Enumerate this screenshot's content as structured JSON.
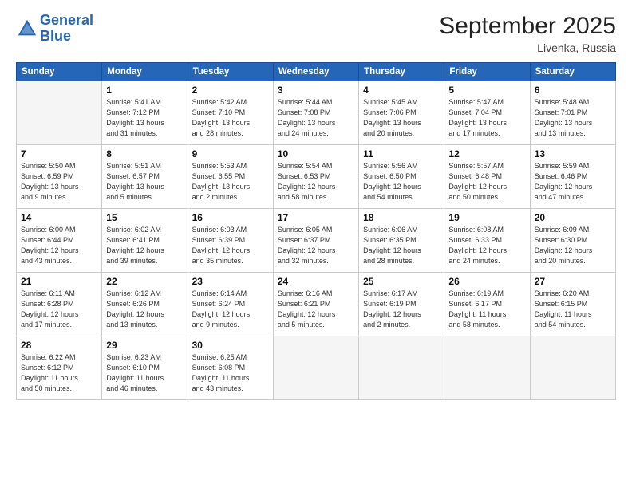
{
  "header": {
    "logo_line1": "General",
    "logo_line2": "Blue",
    "month_title": "September 2025",
    "location": "Livenka, Russia"
  },
  "days_of_week": [
    "Sunday",
    "Monday",
    "Tuesday",
    "Wednesday",
    "Thursday",
    "Friday",
    "Saturday"
  ],
  "weeks": [
    [
      {
        "day": "",
        "info": ""
      },
      {
        "day": "1",
        "info": "Sunrise: 5:41 AM\nSunset: 7:12 PM\nDaylight: 13 hours\nand 31 minutes."
      },
      {
        "day": "2",
        "info": "Sunrise: 5:42 AM\nSunset: 7:10 PM\nDaylight: 13 hours\nand 28 minutes."
      },
      {
        "day": "3",
        "info": "Sunrise: 5:44 AM\nSunset: 7:08 PM\nDaylight: 13 hours\nand 24 minutes."
      },
      {
        "day": "4",
        "info": "Sunrise: 5:45 AM\nSunset: 7:06 PM\nDaylight: 13 hours\nand 20 minutes."
      },
      {
        "day": "5",
        "info": "Sunrise: 5:47 AM\nSunset: 7:04 PM\nDaylight: 13 hours\nand 17 minutes."
      },
      {
        "day": "6",
        "info": "Sunrise: 5:48 AM\nSunset: 7:01 PM\nDaylight: 13 hours\nand 13 minutes."
      }
    ],
    [
      {
        "day": "7",
        "info": "Sunrise: 5:50 AM\nSunset: 6:59 PM\nDaylight: 13 hours\nand 9 minutes."
      },
      {
        "day": "8",
        "info": "Sunrise: 5:51 AM\nSunset: 6:57 PM\nDaylight: 13 hours\nand 5 minutes."
      },
      {
        "day": "9",
        "info": "Sunrise: 5:53 AM\nSunset: 6:55 PM\nDaylight: 13 hours\nand 2 minutes."
      },
      {
        "day": "10",
        "info": "Sunrise: 5:54 AM\nSunset: 6:53 PM\nDaylight: 12 hours\nand 58 minutes."
      },
      {
        "day": "11",
        "info": "Sunrise: 5:56 AM\nSunset: 6:50 PM\nDaylight: 12 hours\nand 54 minutes."
      },
      {
        "day": "12",
        "info": "Sunrise: 5:57 AM\nSunset: 6:48 PM\nDaylight: 12 hours\nand 50 minutes."
      },
      {
        "day": "13",
        "info": "Sunrise: 5:59 AM\nSunset: 6:46 PM\nDaylight: 12 hours\nand 47 minutes."
      }
    ],
    [
      {
        "day": "14",
        "info": "Sunrise: 6:00 AM\nSunset: 6:44 PM\nDaylight: 12 hours\nand 43 minutes."
      },
      {
        "day": "15",
        "info": "Sunrise: 6:02 AM\nSunset: 6:41 PM\nDaylight: 12 hours\nand 39 minutes."
      },
      {
        "day": "16",
        "info": "Sunrise: 6:03 AM\nSunset: 6:39 PM\nDaylight: 12 hours\nand 35 minutes."
      },
      {
        "day": "17",
        "info": "Sunrise: 6:05 AM\nSunset: 6:37 PM\nDaylight: 12 hours\nand 32 minutes."
      },
      {
        "day": "18",
        "info": "Sunrise: 6:06 AM\nSunset: 6:35 PM\nDaylight: 12 hours\nand 28 minutes."
      },
      {
        "day": "19",
        "info": "Sunrise: 6:08 AM\nSunset: 6:33 PM\nDaylight: 12 hours\nand 24 minutes."
      },
      {
        "day": "20",
        "info": "Sunrise: 6:09 AM\nSunset: 6:30 PM\nDaylight: 12 hours\nand 20 minutes."
      }
    ],
    [
      {
        "day": "21",
        "info": "Sunrise: 6:11 AM\nSunset: 6:28 PM\nDaylight: 12 hours\nand 17 minutes."
      },
      {
        "day": "22",
        "info": "Sunrise: 6:12 AM\nSunset: 6:26 PM\nDaylight: 12 hours\nand 13 minutes."
      },
      {
        "day": "23",
        "info": "Sunrise: 6:14 AM\nSunset: 6:24 PM\nDaylight: 12 hours\nand 9 minutes."
      },
      {
        "day": "24",
        "info": "Sunrise: 6:16 AM\nSunset: 6:21 PM\nDaylight: 12 hours\nand 5 minutes."
      },
      {
        "day": "25",
        "info": "Sunrise: 6:17 AM\nSunset: 6:19 PM\nDaylight: 12 hours\nand 2 minutes."
      },
      {
        "day": "26",
        "info": "Sunrise: 6:19 AM\nSunset: 6:17 PM\nDaylight: 11 hours\nand 58 minutes."
      },
      {
        "day": "27",
        "info": "Sunrise: 6:20 AM\nSunset: 6:15 PM\nDaylight: 11 hours\nand 54 minutes."
      }
    ],
    [
      {
        "day": "28",
        "info": "Sunrise: 6:22 AM\nSunset: 6:12 PM\nDaylight: 11 hours\nand 50 minutes."
      },
      {
        "day": "29",
        "info": "Sunrise: 6:23 AM\nSunset: 6:10 PM\nDaylight: 11 hours\nand 46 minutes."
      },
      {
        "day": "30",
        "info": "Sunrise: 6:25 AM\nSunset: 6:08 PM\nDaylight: 11 hours\nand 43 minutes."
      },
      {
        "day": "",
        "info": ""
      },
      {
        "day": "",
        "info": ""
      },
      {
        "day": "",
        "info": ""
      },
      {
        "day": "",
        "info": ""
      }
    ]
  ]
}
